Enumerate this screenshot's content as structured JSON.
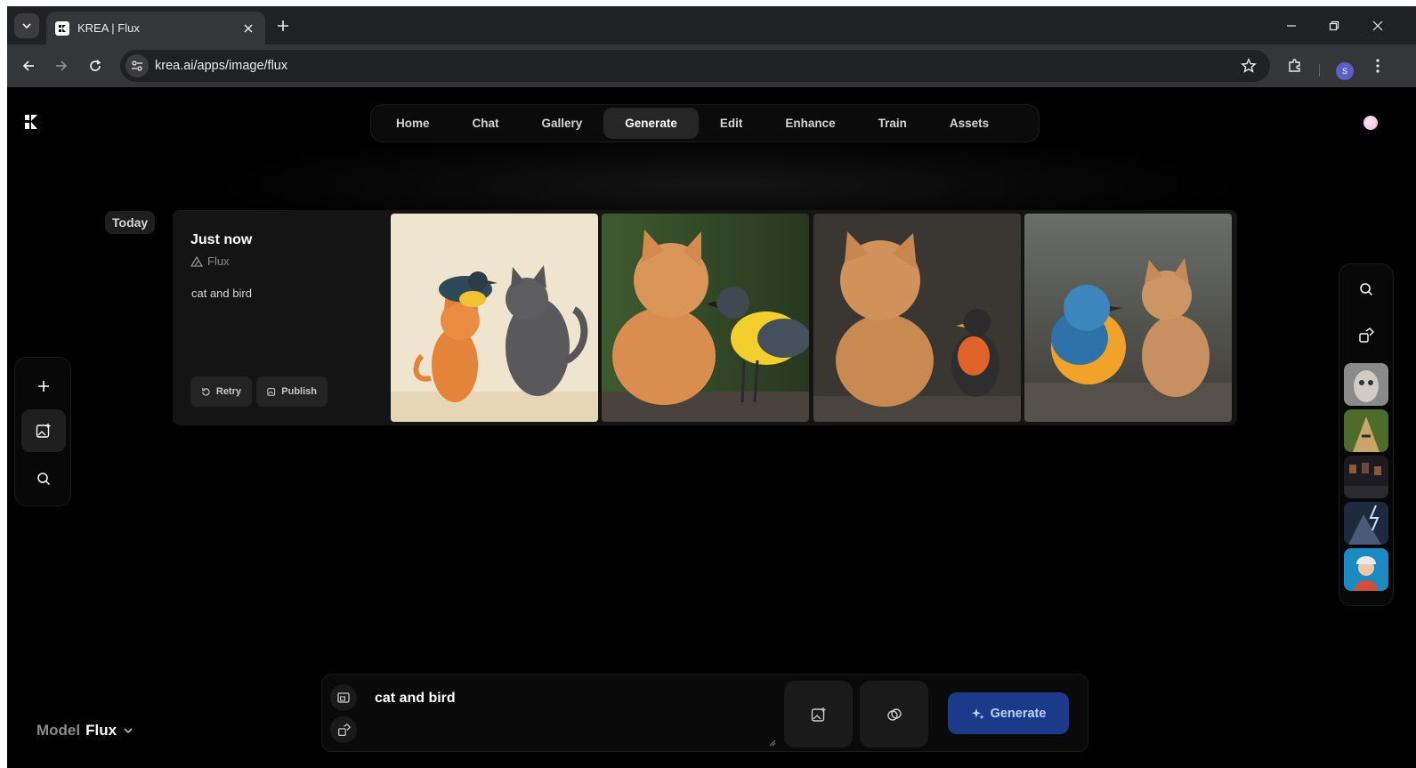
{
  "browser": {
    "tab_title": "KREA | Flux",
    "url": "krea.ai/apps/image/flux",
    "profile_initial": "S"
  },
  "nav": {
    "items": [
      {
        "label": "Home",
        "active": false
      },
      {
        "label": "Chat",
        "active": false
      },
      {
        "label": "Gallery",
        "active": false
      },
      {
        "label": "Generate",
        "active": true
      },
      {
        "label": "Edit",
        "active": false
      },
      {
        "label": "Enhance",
        "active": false
      },
      {
        "label": "Train",
        "active": false
      },
      {
        "label": "Assets",
        "active": false
      }
    ]
  },
  "feed": {
    "day_label": "Today",
    "card": {
      "time": "Just now",
      "model": "Flux",
      "prompt": "cat and bird",
      "retry_label": "Retry",
      "publish_label": "Publish"
    }
  },
  "bottom": {
    "model_label": "Model",
    "model_value": "Flux",
    "prompt_value": "cat and bird",
    "generate_label": "Generate"
  },
  "colors": {
    "page_bg": "#000000",
    "accent_button": "#1c3a8a",
    "accent_text": "#bcd0ff"
  }
}
